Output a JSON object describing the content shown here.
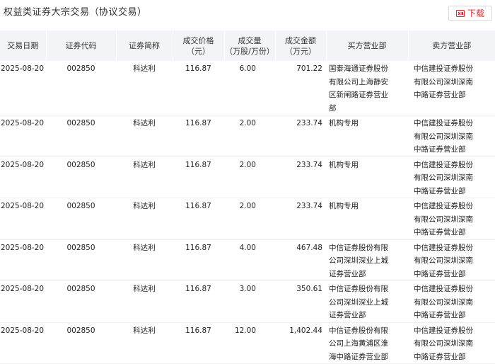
{
  "page": {
    "title": "权益类证券大宗交易（协议交易）",
    "download_label": "下载",
    "download_icon": "excel-download-icon",
    "accent_color": "#e0262e",
    "header_bg": "#f2f4f7"
  },
  "table": {
    "headers": {
      "date": "交易日期",
      "code": "证券代码",
      "name": "证券简称",
      "price_l1": "成交价格",
      "price_l2": "（元）",
      "volume_l1": "成交量",
      "volume_l2": "（万股/万份）",
      "amount_l1": "成交金额",
      "amount_l2": "（万元）",
      "buyer": "买方营业部",
      "seller": "卖方营业部"
    },
    "rows": [
      {
        "date": "2025-08-20",
        "code": "002850",
        "name": "科达利",
        "price": "116.87",
        "volume": "6.00",
        "amount": "701.22",
        "buyer": "国泰海通证券股份\n有限公司上海静安\n区新闸路证券营业\n部",
        "seller": "中信建投证券股份\n有限公司深圳深南\n中路证券营业部"
      },
      {
        "date": "2025-08-20",
        "code": "002850",
        "name": "科达利",
        "price": "116.87",
        "volume": "2.00",
        "amount": "233.74",
        "buyer": "机构专用",
        "seller": "中信建投证券股份\n有限公司深圳深南\n中路证券营业部"
      },
      {
        "date": "2025-08-20",
        "code": "002850",
        "name": "科达利",
        "price": "116.87",
        "volume": "2.00",
        "amount": "233.74",
        "buyer": "机构专用",
        "seller": "中信建投证券股份\n有限公司深圳深南\n中路证券营业部"
      },
      {
        "date": "2025-08-20",
        "code": "002850",
        "name": "科达利",
        "price": "116.87",
        "volume": "2.00",
        "amount": "233.74",
        "buyer": "机构专用",
        "seller": "中信建投证券股份\n有限公司深圳深南\n中路证券营业部"
      },
      {
        "date": "2025-08-20",
        "code": "002850",
        "name": "科达利",
        "price": "116.87",
        "volume": "4.00",
        "amount": "467.48",
        "buyer": "中信证券股份有限\n公司深圳深业上城\n证券营业部",
        "seller": "中信建投证券股份\n有限公司深圳深南\n中路证券营业部"
      },
      {
        "date": "2025-08-20",
        "code": "002850",
        "name": "科达利",
        "price": "116.87",
        "volume": "3.00",
        "amount": "350.61",
        "buyer": "中信证券股份有限\n公司深圳深业上城\n证券营业部",
        "seller": "中信建投证券股份\n有限公司深圳深南\n中路证券营业部"
      },
      {
        "date": "2025-08-20",
        "code": "002850",
        "name": "科达利",
        "price": "116.87",
        "volume": "12.00",
        "amount": "1,402.44",
        "buyer": "中信证券股份有限\n公司上海黄浦区淮\n海中路证券营业部",
        "seller": "中信建投证券股份\n有限公司深圳深南\n中路证券营业部"
      }
    ]
  }
}
